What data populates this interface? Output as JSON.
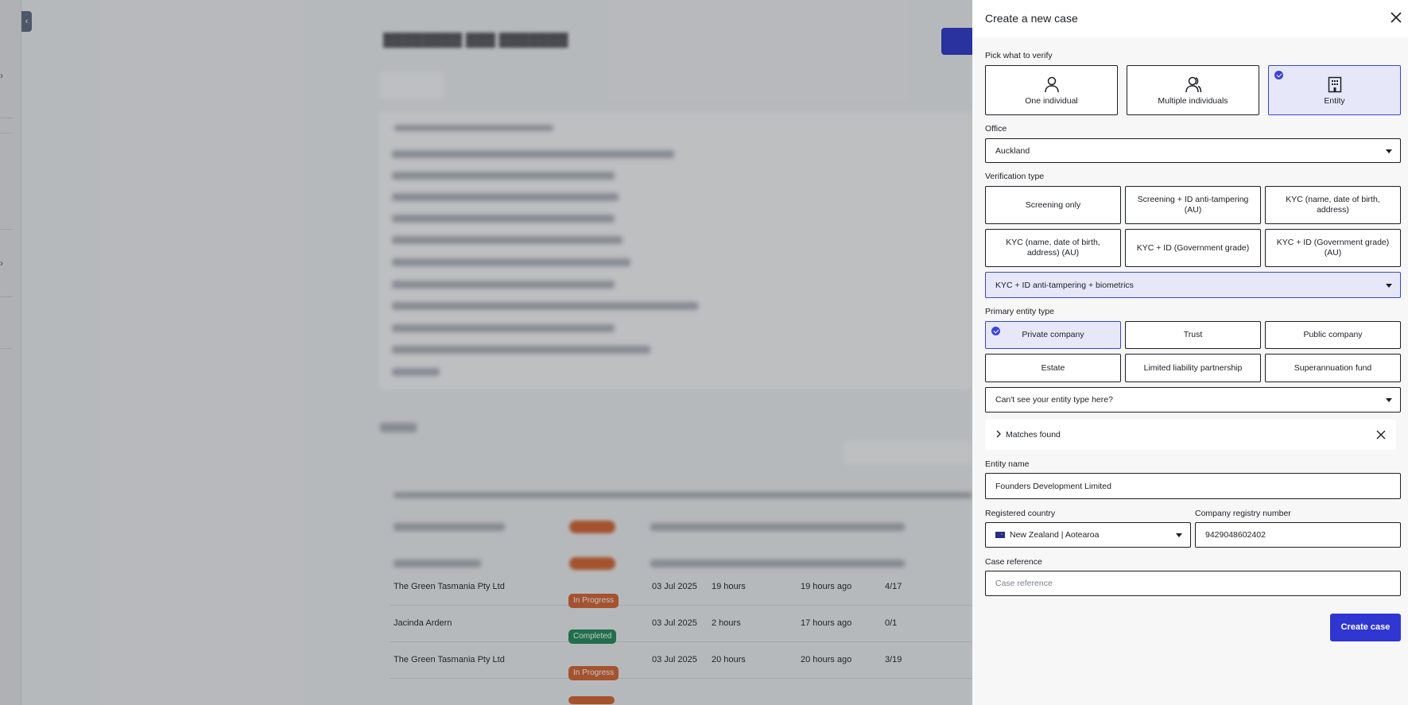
{
  "background": {
    "table_rows": [
      {
        "name": "The Green Tasmania Pty Ltd",
        "status": "In Progress",
        "date": "03 Jul 2025",
        "duration": "19 hours",
        "ago": "19 hours ago",
        "count": "4/17"
      },
      {
        "name": "Jacinda Ardern",
        "status": "Completed",
        "date": "03 Jul 2025",
        "duration": "2 hours",
        "ago": "17 hours ago",
        "count": "0/1"
      },
      {
        "name": "The Green Tasmania Pty Ltd",
        "status": "In Progress",
        "date": "03 Jul 2025",
        "duration": "20 hours",
        "ago": "20 hours ago",
        "count": "3/19"
      }
    ],
    "colors": {
      "in_progress": "#d4632d",
      "completed": "#1f8a57"
    }
  },
  "drawer": {
    "title": "Create a new case",
    "verify": {
      "label": "Pick what to verify",
      "options": [
        {
          "label": "One individual",
          "icon": "person-icon",
          "selected": false
        },
        {
          "label": "Multiple individuals",
          "icon": "people-icon",
          "selected": false
        },
        {
          "label": "Entity",
          "icon": "building-icon",
          "selected": true
        }
      ]
    },
    "office": {
      "label": "Office",
      "value": "Auckland"
    },
    "verification_type": {
      "label": "Verification type",
      "options": [
        "Screening only",
        "Screening + ID anti-tampering (AU)",
        "KYC (name, date of birth, address)",
        "KYC (name, date of birth, address) (AU)",
        "KYC + ID (Government grade)",
        "KYC + ID (Government grade) (AU)"
      ],
      "selected_dropdown": "KYC + ID anti-tampering + biometrics"
    },
    "entity_type": {
      "label": "Primary entity type",
      "options": [
        "Private company",
        "Trust",
        "Public company",
        "Estate",
        "Limited liability partnership",
        "Superannuation fund"
      ],
      "selected": "Private company",
      "other_placeholder": "Can't see your entity type here?"
    },
    "matches": {
      "label": "Matches found"
    },
    "entity_name": {
      "label": "Entity name",
      "value": "Founders Development Limited"
    },
    "country": {
      "label": "Registered country",
      "value": "New Zealand | Aotearoa"
    },
    "registry": {
      "label": "Company registry number",
      "value": "9429048602402"
    },
    "case_reference": {
      "label": "Case reference",
      "placeholder": "Case reference"
    },
    "submit_label": "Create case",
    "accent": "#2f36d1"
  }
}
